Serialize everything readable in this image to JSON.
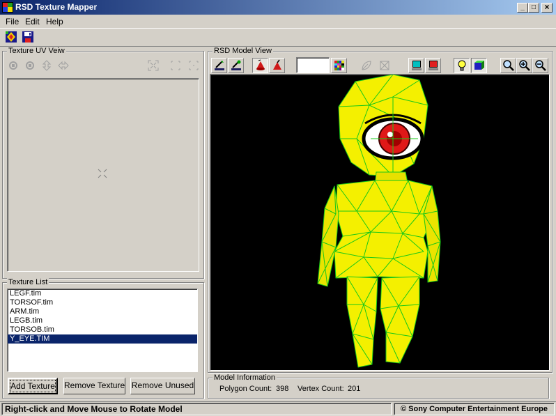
{
  "window": {
    "title": "RSD Texture Mapper",
    "minimize": "_",
    "maximize": "□",
    "close": "×"
  },
  "menu": [
    "File",
    "Edit",
    "Help"
  ],
  "uv_view": {
    "label": "Texture UV Veiw"
  },
  "model_view": {
    "label": "RSD Model View"
  },
  "texture_list": {
    "label": "Texture List",
    "items": [
      "LEGF.tim",
      "TORSOF.tim",
      "ARM.tim",
      "LEGB.tim",
      "TORSOB.tim",
      "Y_EYE.TIM"
    ],
    "selected_index": 5
  },
  "buttons": {
    "add": "Add Texture",
    "remove": "Remove Texture",
    "remove_unused": "Remove Unused"
  },
  "model_info": {
    "label": "Model Information",
    "polygon_label": "Polygon Count:",
    "polygon_value": "398",
    "vertex_label": "Vertex Count:",
    "vertex_value": "201"
  },
  "status": {
    "hint": "Right-click and Move Mouse to Rotate Model",
    "copyright": "© Sony Computer Entertainment Europe"
  },
  "colors": {
    "titlebar": "#0a246a",
    "selection": "#0a246a",
    "viewport_bg": "#000000",
    "model_fill": "#f4f000",
    "wire": "#18c818"
  }
}
